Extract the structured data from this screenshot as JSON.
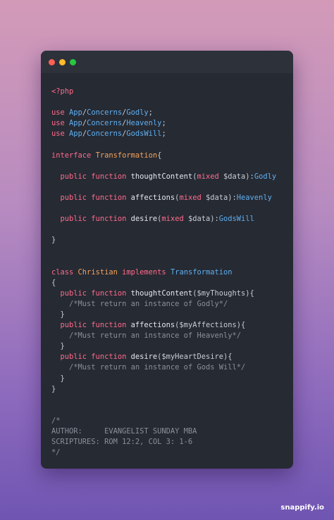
{
  "window": {
    "controls": [
      "close",
      "minimize",
      "maximize"
    ]
  },
  "code": {
    "lines": [
      [
        {
          "t": "<?php",
          "c": "tag"
        }
      ],
      [],
      [
        {
          "t": "use ",
          "c": "kw"
        },
        {
          "t": "App",
          "c": "ty"
        },
        {
          "t": "/",
          "c": "pu"
        },
        {
          "t": "Concerns",
          "c": "ty"
        },
        {
          "t": "/",
          "c": "pu"
        },
        {
          "t": "Godly",
          "c": "ty"
        },
        {
          "t": ";",
          "c": "pu"
        }
      ],
      [
        {
          "t": "use ",
          "c": "kw"
        },
        {
          "t": "App",
          "c": "ty"
        },
        {
          "t": "/",
          "c": "pu"
        },
        {
          "t": "Concerns",
          "c": "ty"
        },
        {
          "t": "/",
          "c": "pu"
        },
        {
          "t": "Heavenly",
          "c": "ty"
        },
        {
          "t": ";",
          "c": "pu"
        }
      ],
      [
        {
          "t": "use ",
          "c": "kw"
        },
        {
          "t": "App",
          "c": "ty"
        },
        {
          "t": "/",
          "c": "pu"
        },
        {
          "t": "Concerns",
          "c": "ty"
        },
        {
          "t": "/",
          "c": "pu"
        },
        {
          "t": "GodsWill",
          "c": "ty"
        },
        {
          "t": ";",
          "c": "pu"
        }
      ],
      [],
      [
        {
          "t": "interface ",
          "c": "kw"
        },
        {
          "t": "Transformation",
          "c": "cls"
        },
        {
          "t": "{",
          "c": "pu"
        }
      ],
      [],
      [
        {
          "t": "  public function ",
          "c": "kw"
        },
        {
          "t": "thoughtContent",
          "c": "fn"
        },
        {
          "t": "(",
          "c": "pu"
        },
        {
          "t": "mixed ",
          "c": "kw"
        },
        {
          "t": "$data",
          "c": "pu"
        },
        {
          "t": "):",
          "c": "pu"
        },
        {
          "t": "Godly",
          "c": "ty"
        }
      ],
      [],
      [
        {
          "t": "  public function ",
          "c": "kw"
        },
        {
          "t": "affections",
          "c": "fn"
        },
        {
          "t": "(",
          "c": "pu"
        },
        {
          "t": "mixed ",
          "c": "kw"
        },
        {
          "t": "$data",
          "c": "pu"
        },
        {
          "t": "):",
          "c": "pu"
        },
        {
          "t": "Heavenly",
          "c": "ty"
        }
      ],
      [],
      [
        {
          "t": "  public function ",
          "c": "kw"
        },
        {
          "t": "desire",
          "c": "fn"
        },
        {
          "t": "(",
          "c": "pu"
        },
        {
          "t": "mixed ",
          "c": "kw"
        },
        {
          "t": "$data",
          "c": "pu"
        },
        {
          "t": "):",
          "c": "pu"
        },
        {
          "t": "GodsWill",
          "c": "ty"
        }
      ],
      [],
      [
        {
          "t": "}",
          "c": "pu"
        }
      ],
      [],
      [],
      [
        {
          "t": "class ",
          "c": "kw"
        },
        {
          "t": "Christian ",
          "c": "cls"
        },
        {
          "t": "implements ",
          "c": "kw"
        },
        {
          "t": "Transformation",
          "c": "ty"
        }
      ],
      [
        {
          "t": "{",
          "c": "pu"
        }
      ],
      [
        {
          "t": "  public function ",
          "c": "kw"
        },
        {
          "t": "thoughtContent",
          "c": "fn"
        },
        {
          "t": "($myThoughts){",
          "c": "pu"
        }
      ],
      [
        {
          "t": "    /*Must return an instance of Godly*/",
          "c": "cm"
        }
      ],
      [
        {
          "t": "  }",
          "c": "pu"
        }
      ],
      [
        {
          "t": "  public function ",
          "c": "kw"
        },
        {
          "t": "affections",
          "c": "fn"
        },
        {
          "t": "($myAffections){",
          "c": "pu"
        }
      ],
      [
        {
          "t": "    /*Must return an instance of Heavenly*/",
          "c": "cm"
        }
      ],
      [
        {
          "t": "  }",
          "c": "pu"
        }
      ],
      [
        {
          "t": "  public function ",
          "c": "kw"
        },
        {
          "t": "desire",
          "c": "fn"
        },
        {
          "t": "($myHeartDesire){",
          "c": "pu"
        }
      ],
      [
        {
          "t": "    /*Must return an instance of Gods Will*/",
          "c": "cm"
        }
      ],
      [
        {
          "t": "  }",
          "c": "pu"
        }
      ],
      [
        {
          "t": "}",
          "c": "pu"
        }
      ],
      [],
      [],
      [
        {
          "t": "/*",
          "c": "cm"
        }
      ],
      [
        {
          "t": "AUTHOR:     EVANGELIST SUNDAY MBA",
          "c": "cm"
        }
      ],
      [
        {
          "t": "SCRIPTURES: ROM 12:2, COL 3: 1-6",
          "c": "cm"
        }
      ],
      [
        {
          "t": "*/",
          "c": "cm"
        }
      ]
    ]
  },
  "brand": {
    "label": "snappify.io"
  },
  "colors": {
    "background_top": "#d39ab8",
    "background_bottom": "#6f55b2",
    "editor_bg": "#262a33",
    "keyword": "#ff6b8b",
    "type": "#61afef",
    "class_name": "#f5a35b",
    "comment": "#8a8f99"
  }
}
